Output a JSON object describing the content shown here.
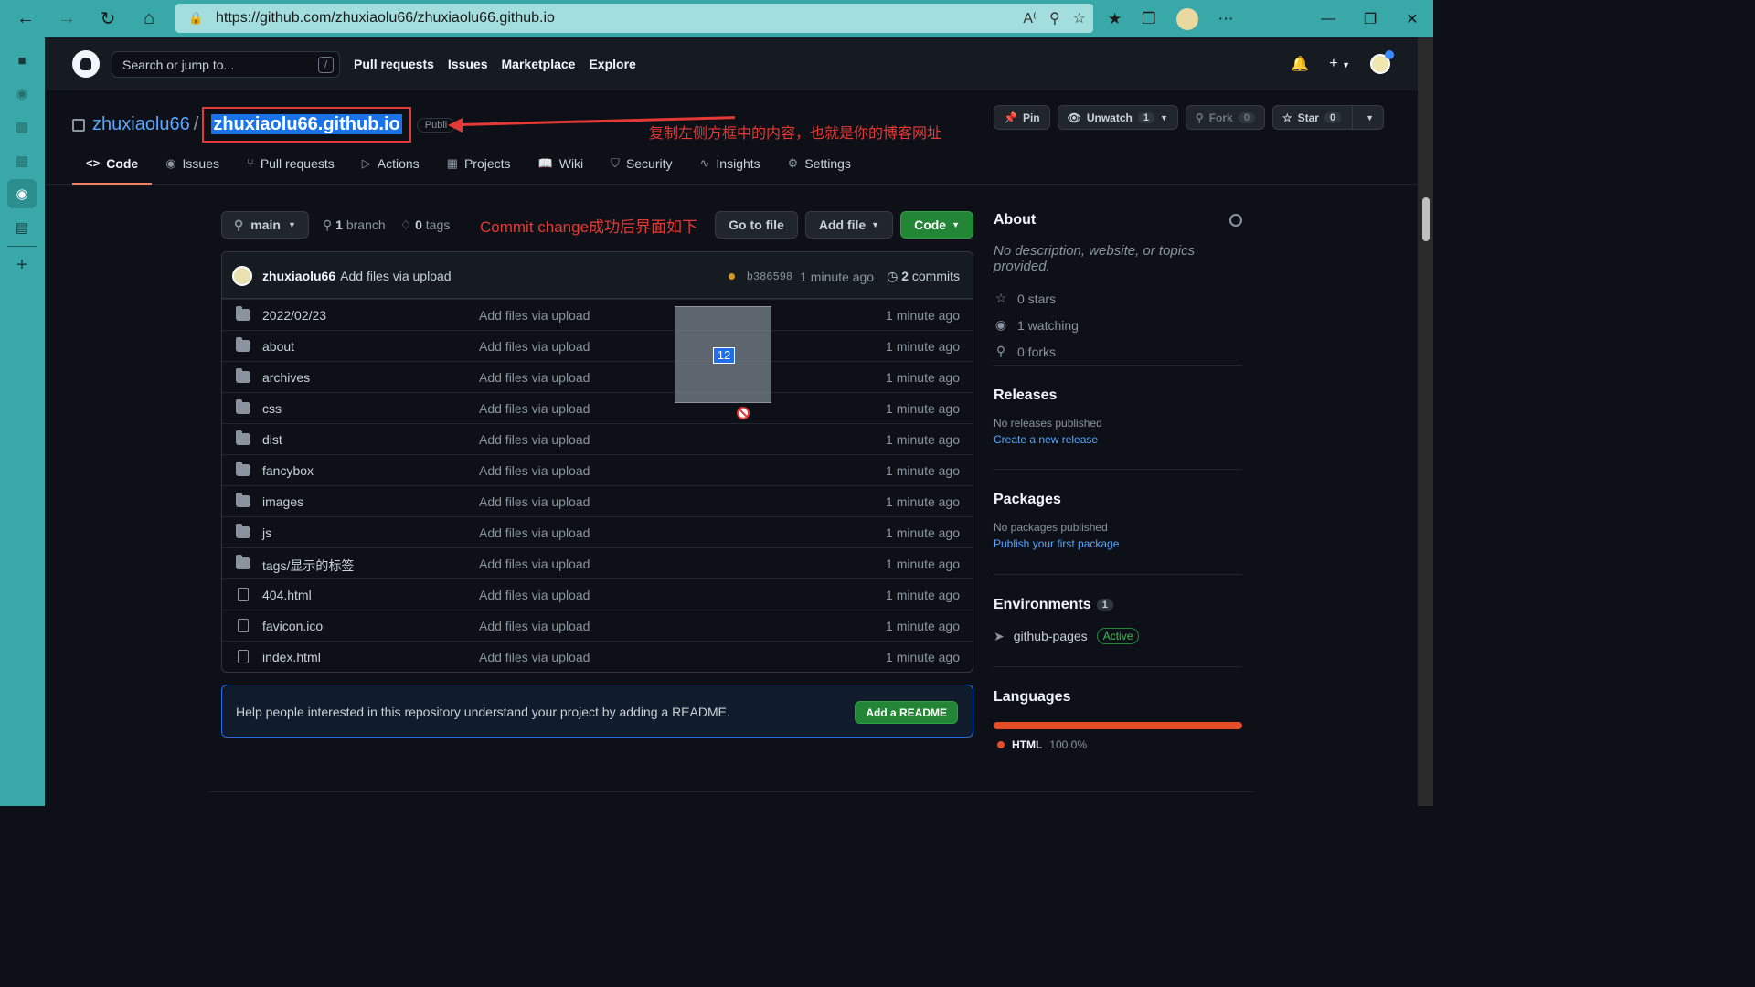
{
  "browser": {
    "url": "https://github.com/zhuxiaolu66/zhuxiaolu66.github.io"
  },
  "gh_header": {
    "search_placeholder": "Search or jump to...",
    "search_shortcut": "/",
    "nav": [
      "Pull requests",
      "Issues",
      "Marketplace",
      "Explore"
    ]
  },
  "repo": {
    "owner": "zhuxiaolu66",
    "separator": "/",
    "name": "zhuxiaolu66.github.io",
    "visibility": "Publi",
    "annotation": "复制左侧方框中的内容，也就是你的博客网址",
    "pin_label": "Pin",
    "unwatch_label": "Unwatch",
    "unwatch_count": "1",
    "fork_label": "Fork",
    "fork_count": "0",
    "star_label": "Star",
    "star_count": "0"
  },
  "tabs": [
    {
      "label": "Code",
      "icon": "<>"
    },
    {
      "label": "Issues",
      "icon": "◉"
    },
    {
      "label": "Pull requests",
      "icon": "⑂"
    },
    {
      "label": "Actions",
      "icon": "▷"
    },
    {
      "label": "Projects",
      "icon": "▦"
    },
    {
      "label": "Wiki",
      "icon": "📖"
    },
    {
      "label": "Security",
      "icon": "⛉"
    },
    {
      "label": "Insights",
      "icon": "∿"
    },
    {
      "label": "Settings",
      "icon": "⚙"
    }
  ],
  "toolbar": {
    "branch": "main",
    "branch_count": "1",
    "branch_word": "branch",
    "tag_count": "0",
    "tag_word": "tags",
    "annotation": "Commit change成功后界面如下",
    "goto_file": "Go to file",
    "add_file": "Add file",
    "code": "Code"
  },
  "commit": {
    "author": "zhuxiaolu66",
    "message": "Add files via upload",
    "sha": "b386598",
    "time": "1 minute ago",
    "commit_count": "2",
    "commit_word": "commits"
  },
  "files": [
    {
      "type": "folder",
      "name": "2022/02/23",
      "message": "Add files via upload",
      "time": "1 minute ago"
    },
    {
      "type": "folder",
      "name": "about",
      "message": "Add files via upload",
      "time": "1 minute ago"
    },
    {
      "type": "folder",
      "name": "archives",
      "message": "Add files via upload",
      "time": "1 minute ago"
    },
    {
      "type": "folder",
      "name": "css",
      "message": "Add files via upload",
      "time": "1 minute ago"
    },
    {
      "type": "folder",
      "name": "dist",
      "message": "Add files via upload",
      "time": "1 minute ago"
    },
    {
      "type": "folder",
      "name": "fancybox",
      "message": "Add files via upload",
      "time": "1 minute ago"
    },
    {
      "type": "folder",
      "name": "images",
      "message": "Add files via upload",
      "time": "1 minute ago"
    },
    {
      "type": "folder",
      "name": "js",
      "message": "Add files via upload",
      "time": "1 minute ago"
    },
    {
      "type": "folder",
      "name": "tags/显示的标签",
      "message": "Add files via upload",
      "time": "1 minute ago"
    },
    {
      "type": "file",
      "name": "404.html",
      "message": "Add files via upload",
      "time": "1 minute ago"
    },
    {
      "type": "file",
      "name": "favicon.ico",
      "message": "Add files via upload",
      "time": "1 minute ago"
    },
    {
      "type": "file",
      "name": "index.html",
      "message": "Add files via upload",
      "time": "1 minute ago"
    }
  ],
  "drag": {
    "badge": "12"
  },
  "readme": {
    "text": "Help people interested in this repository understand your project by adding a README.",
    "button": "Add a README"
  },
  "about": {
    "title": "About",
    "description": "No description, website, or topics provided.",
    "stars": "0 stars",
    "watching": "1 watching",
    "forks": "0 forks"
  },
  "releases": {
    "title": "Releases",
    "empty": "No releases published",
    "link": "Create a new release"
  },
  "packages": {
    "title": "Packages",
    "empty": "No packages published",
    "link": "Publish your first package"
  },
  "environments": {
    "title": "Environments",
    "count": "1",
    "name": "github-pages",
    "status": "Active"
  },
  "languages": {
    "title": "Languages",
    "name": "HTML",
    "percent": "100.0%",
    "fraction": 1.0,
    "color": "#e34c26"
  },
  "colors": {
    "accent": "#58a6ff",
    "annotation": "#e53935",
    "green": "#238636",
    "chrome": "#38a8a8"
  }
}
